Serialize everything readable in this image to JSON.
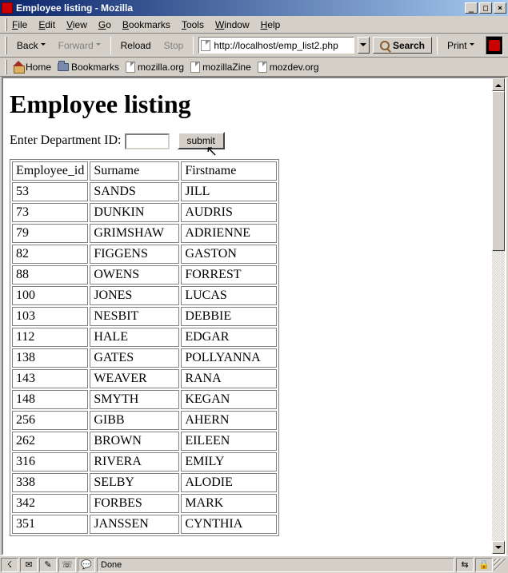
{
  "window": {
    "title": "Employee listing - Mozilla",
    "min": "_",
    "max": "□",
    "close": "×"
  },
  "menubar": {
    "file": "File",
    "edit": "Edit",
    "view": "View",
    "go": "Go",
    "bookmarks": "Bookmarks",
    "tools": "Tools",
    "window": "Window",
    "help": "Help"
  },
  "toolbar": {
    "back": "Back",
    "forward": "Forward",
    "reload": "Reload",
    "stop": "Stop",
    "url": "http://localhost/emp_list2.php",
    "search": "Search",
    "print": "Print"
  },
  "bookmarkbar": {
    "home": "Home",
    "bookmarks": "Bookmarks",
    "items": [
      "mozilla.org",
      "mozillaZine",
      "mozdev.org"
    ]
  },
  "page": {
    "heading": "Employee listing",
    "form_label": "Enter Department ID:",
    "dept_value": "",
    "submit_label": "submit",
    "columns": [
      "Employee_id",
      "Surname",
      "Firstname"
    ],
    "rows": [
      {
        "id": "53",
        "surname": "SANDS",
        "firstname": "JILL"
      },
      {
        "id": "73",
        "surname": "DUNKIN",
        "firstname": "AUDRIS"
      },
      {
        "id": "79",
        "surname": "GRIMSHAW",
        "firstname": "ADRIENNE"
      },
      {
        "id": "82",
        "surname": "FIGGENS",
        "firstname": "GASTON"
      },
      {
        "id": "88",
        "surname": "OWENS",
        "firstname": "FORREST"
      },
      {
        "id": "100",
        "surname": "JONES",
        "firstname": "LUCAS"
      },
      {
        "id": "103",
        "surname": "NESBIT",
        "firstname": "DEBBIE"
      },
      {
        "id": "112",
        "surname": "HALE",
        "firstname": "EDGAR"
      },
      {
        "id": "138",
        "surname": "GATES",
        "firstname": "POLLYANNA"
      },
      {
        "id": "143",
        "surname": "WEAVER",
        "firstname": "RANA"
      },
      {
        "id": "148",
        "surname": "SMYTH",
        "firstname": "KEGAN"
      },
      {
        "id": "256",
        "surname": "GIBB",
        "firstname": "AHERN"
      },
      {
        "id": "262",
        "surname": "BROWN",
        "firstname": "EILEEN"
      },
      {
        "id": "316",
        "surname": "RIVERA",
        "firstname": "EMILY"
      },
      {
        "id": "338",
        "surname": "SELBY",
        "firstname": "ALODIE"
      },
      {
        "id": "342",
        "surname": "FORBES",
        "firstname": "MARK"
      },
      {
        "id": "351",
        "surname": "JANSSEN",
        "firstname": "CYNTHIA"
      }
    ]
  },
  "statusbar": {
    "text": "Done"
  }
}
